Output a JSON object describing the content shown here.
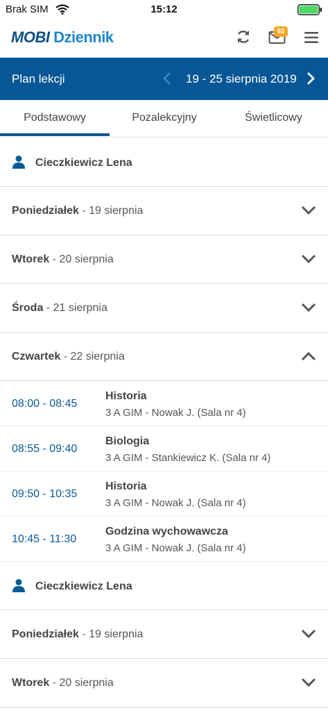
{
  "status_bar": {
    "carrier": "Brak SIM",
    "time": "15:12"
  },
  "header": {
    "logo_part1": "mobi",
    "logo_part2": "Dziennik",
    "mail_badge": "92"
  },
  "plan": {
    "title": "Plan lekcji",
    "date_range": "19 - 25 sierpnia 2019"
  },
  "tabs": [
    {
      "label": "Podstawowy",
      "active": true
    },
    {
      "label": "Pozalekcyjny",
      "active": false
    },
    {
      "label": "Świetlicowy",
      "active": false
    }
  ],
  "sections": [
    {
      "person": "Cieczkiewicz Lena",
      "days": [
        {
          "name": "Poniedziałek",
          "separator": "-",
          "date": "19 sierpnia",
          "expanded": false
        },
        {
          "name": "Wtorek",
          "separator": "-",
          "date": "20 sierpnia",
          "expanded": false
        },
        {
          "name": "Środa",
          "separator": "-",
          "date": "21 sierpnia",
          "expanded": false
        },
        {
          "name": "Czwartek",
          "separator": "-",
          "date": "22 sierpnia",
          "expanded": true,
          "lessons": [
            {
              "time": "08:00 - 08:45",
              "subject": "Historia",
              "detail": "3 A GIM - Nowak J. (Sala nr 4)"
            },
            {
              "time": "08:55 - 09:40",
              "subject": "Biologia",
              "detail": "3 A GIM - Stankiewicz K. (Sala nr 4)"
            },
            {
              "time": "09:50 - 10:35",
              "subject": "Historia",
              "detail": "3 A GIM - Nowak J. (Sala nr 4)"
            },
            {
              "time": "10:45 - 11:30",
              "subject": "Godzina wychowawcza",
              "detail": "3 A GIM - Nowak J. (Sala nr 4)"
            }
          ]
        }
      ]
    },
    {
      "person": "Cieczkiewicz Lena",
      "days": [
        {
          "name": "Poniedziałek",
          "separator": "-",
          "date": "19 sierpnia",
          "expanded": false
        },
        {
          "name": "Wtorek",
          "separator": "-",
          "date": "20 sierpnia",
          "expanded": false
        }
      ]
    }
  ],
  "colors": {
    "brand_blue": "#075796",
    "link_blue": "#0a5a96",
    "badge_orange": "#f5a623",
    "battery_green": "#4cd964"
  },
  "icons": [
    "wifi-icon",
    "battery-icon",
    "refresh-icon",
    "mail-icon",
    "menu-icon",
    "chevron-left-icon",
    "chevron-right-icon",
    "user-icon",
    "chevron-down-icon",
    "chevron-up-icon"
  ]
}
